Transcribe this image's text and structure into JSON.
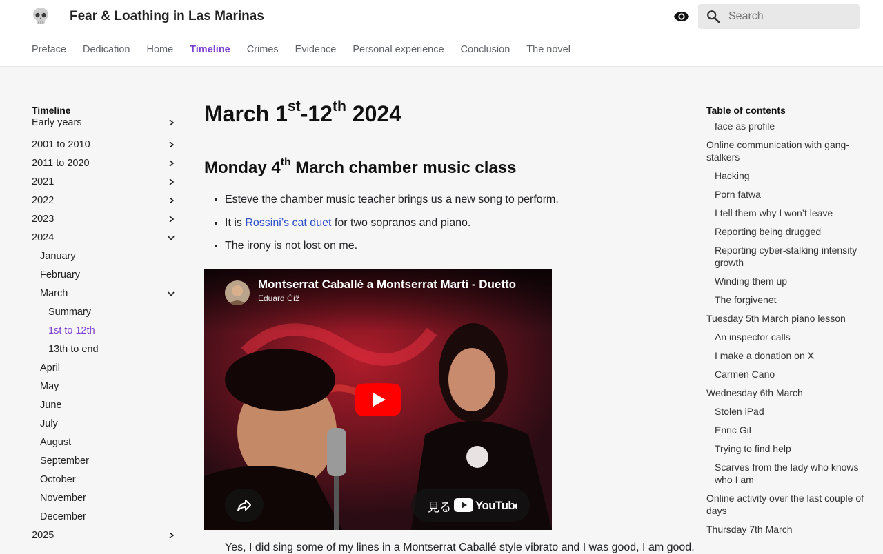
{
  "header": {
    "site_title": "Fear & Loathing in Las Marinas",
    "search_placeholder": "Search",
    "tabs": [
      {
        "label": "Preface"
      },
      {
        "label": "Dedication"
      },
      {
        "label": "Home"
      },
      {
        "label": "Timeline",
        "active": true
      },
      {
        "label": "Crimes"
      },
      {
        "label": "Evidence"
      },
      {
        "label": "Personal experience"
      },
      {
        "label": "Conclusion"
      },
      {
        "label": "The novel"
      }
    ]
  },
  "nav": {
    "title": "Timeline",
    "items": [
      {
        "label": "Early years",
        "level": 0,
        "chevron": "right"
      },
      {
        "label": "2001 to 2010",
        "level": 0,
        "chevron": "right"
      },
      {
        "label": "2011 to 2020",
        "level": 0,
        "chevron": "right"
      },
      {
        "label": "2021",
        "level": 0,
        "chevron": "right"
      },
      {
        "label": "2022",
        "level": 0,
        "chevron": "right"
      },
      {
        "label": "2023",
        "level": 0,
        "chevron": "right"
      },
      {
        "label": "2024",
        "level": 0,
        "chevron": "down"
      },
      {
        "label": "January",
        "level": 1
      },
      {
        "label": "February",
        "level": 1
      },
      {
        "label": "March",
        "level": 1,
        "chevron": "down"
      },
      {
        "label": "Summary",
        "level": 2
      },
      {
        "label": "1st to 12th",
        "level": 2,
        "current": true
      },
      {
        "label": "13th to end",
        "level": 2
      },
      {
        "label": "April",
        "level": 1
      },
      {
        "label": "May",
        "level": 1
      },
      {
        "label": "June",
        "level": 1
      },
      {
        "label": "July",
        "level": 1
      },
      {
        "label": "August",
        "level": 1
      },
      {
        "label": "September",
        "level": 1
      },
      {
        "label": "October",
        "level": 1
      },
      {
        "label": "November",
        "level": 1
      },
      {
        "label": "December",
        "level": 1
      },
      {
        "label": "2025",
        "level": 0,
        "chevron": "right"
      }
    ]
  },
  "main": {
    "h1": {
      "a": "March 1",
      "sup1": "st",
      "b": "-12",
      "sup2": "th",
      "c": " 2024"
    },
    "h2": {
      "a": "Monday 4",
      "sup": "th",
      "b": " March chamber music class"
    },
    "bullet1": "Esteve the chamber music teacher brings us a new song to perform.",
    "bullet2_pre": "It is ",
    "bullet2_link": "Rossini’s cat duet",
    "bullet2_post": " for two sopranos and piano.",
    "bullet3": "The irony is not lost on me.",
    "video": {
      "title": "Montserrat Caballé a Montserrat Martí - Duetto",
      "channel": "Eduard Číž",
      "watch_label": "見る",
      "youtube_label": "YouTube"
    },
    "cut_text": "Yes, I did sing some of my lines in a Montserrat Caballé style vibrato and I was good, I am good."
  },
  "toc": {
    "title": "Table of contents",
    "items": [
      {
        "label": "face as profile",
        "sub": true
      },
      {
        "label": "Online communication with gang-stalkers",
        "sub": false
      },
      {
        "label": "Hacking",
        "sub": true
      },
      {
        "label": "Porn fatwa",
        "sub": true
      },
      {
        "label": "I tell them why I won’t leave",
        "sub": true
      },
      {
        "label": "Reporting being drugged",
        "sub": true
      },
      {
        "label": "Reporting cyber-stalking intensity growth",
        "sub": true
      },
      {
        "label": "Winding them up",
        "sub": true
      },
      {
        "label": "The forgivenet",
        "sub": true
      },
      {
        "label": "Tuesday 5th March piano lesson",
        "sub": false
      },
      {
        "label": "An inspector calls",
        "sub": true
      },
      {
        "label": "I make a donation on X",
        "sub": true
      },
      {
        "label": "Carmen Cano",
        "sub": true
      },
      {
        "label": "Wednesday 6th March",
        "sub": false
      },
      {
        "label": "Stolen iPad",
        "sub": true
      },
      {
        "label": "Enric Gil",
        "sub": true
      },
      {
        "label": "Trying to find help",
        "sub": true
      },
      {
        "label": "Scarves from the lady who knows who I am",
        "sub": true
      },
      {
        "label": "Online activity over the last couple of days",
        "sub": false
      },
      {
        "label": "Thursday 7th March",
        "sub": false
      }
    ]
  },
  "colors": {
    "accent": "#7b3fd1",
    "link": "#2f4fc9",
    "youtube_red": "#ff0000"
  },
  "icons": [
    "skull-icon",
    "eye-icon",
    "search-icon",
    "chevron-right-icon",
    "chevron-down-icon",
    "play-icon",
    "share-icon",
    "youtube-logo-icon"
  ]
}
